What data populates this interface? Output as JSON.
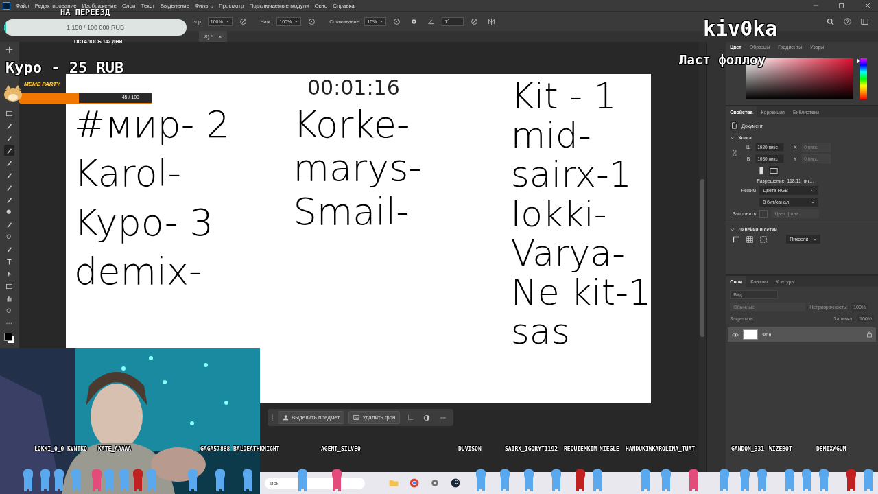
{
  "menu": [
    "Файл",
    "Редактирование",
    "Изображение",
    "Слои",
    "Текст",
    "Выделение",
    "Фильтр",
    "Просмотр",
    "Подключаемые модули",
    "Окно",
    "Справка"
  ],
  "options": [
    {
      "label": "зор.:",
      "value": "100%"
    },
    {
      "label": "Наж.:",
      "value": "100%"
    },
    {
      "label": "Сглаживание:",
      "value": "10%"
    }
  ],
  "angle": "1°",
  "document_tab": {
    "title": "8) *",
    "close": "×"
  },
  "canvas": {
    "columns": [
      [
        "#мир- 2",
        "Karol-",
        "Kypo- 3",
        "demix-"
      ],
      [
        "Korke-",
        "marys-",
        "Smail-"
      ],
      [
        "Kit - 1",
        "mid-",
        "sairx-1",
        "lokki-",
        "Varya-",
        "Ne kit-1",
        "sas"
      ]
    ]
  },
  "color_panel": {
    "tabs": [
      {
        "label": "Цвет",
        "selected": true
      },
      {
        "label": "Образцы",
        "selected": false
      },
      {
        "label": "Градиенты",
        "selected": false
      },
      {
        "label": "Узоры",
        "selected": false
      }
    ],
    "hue": {
      "level": 1
    }
  },
  "properties": {
    "tabs": [
      {
        "label": "Свойства",
        "selected": true
      },
      {
        "label": "Коррекция",
        "selected": false
      },
      {
        "label": "Библиотеки",
        "selected": false
      }
    ],
    "document": "Документ",
    "canvas_section": "Холст",
    "fields": [
      {
        "label": "Ш",
        "value": "1920 пикс",
        "pos_label": "X",
        "pos_placeholder": "0 пикс."
      },
      {
        "label": "В",
        "value": "1080 пикс",
        "pos_label": "Y",
        "pos_placeholder": "0 пикс."
      }
    ],
    "resolution": "Разрешение: 118,11 пик...",
    "mode_label": "Режим",
    "mode": "Цвета RGB",
    "depth": "8 бит/канал",
    "fill_label": "Заполнить",
    "fill_value": "Цвет фона",
    "rulers_section": "Линейки и сетки",
    "units": "Пиксели"
  },
  "layers": {
    "tabs": [
      {
        "label": "Слои",
        "selected": true
      },
      {
        "label": "Каналы",
        "selected": false
      },
      {
        "label": "Контуры",
        "selected": false
      }
    ],
    "search_placeholder": "Вид",
    "blend": "Обычные",
    "opacity_label": "Непрозрачность:",
    "opacity": "100%",
    "lock_label": "Закрепить:",
    "fill_label": "Заливка:",
    "fill": "100%",
    "items": [
      {
        "name": "Фон",
        "visible": true,
        "locked": true
      }
    ]
  },
  "context_bar": {
    "buttons": [
      "Выделить предмет",
      "Удалить фон"
    ]
  },
  "taskbar": {
    "search": "иск"
  },
  "overlays": {
    "goal": {
      "title": "НА ПЕРЕЕЗД",
      "amount": "1 150 / 100 000 RUB",
      "level": 0.0115,
      "remaining": "ОСТАЛОСЬ 142 ДНЯ"
    },
    "last_donation": "Куро - 25 RUB",
    "meme": {
      "title": "MEME PARTY",
      "count": "45 / 100",
      "level": 0.45
    },
    "streamer": "kiv0ka",
    "last_follow": "Ласт фоллоу",
    "timer": "00:01:16",
    "chat_names": [
      "LOKKI_0_0",
      "KVNTKO",
      "KATE_AAAAA",
      "GAGA57888",
      "BALDEATHKNIGHT",
      "AGENT_SILVE0",
      "DUVISON",
      "SAIRX_IGORYT1192",
      "REQUIEMKIM",
      "NIEGLE",
      "HANDUKIWKAROLINA_TUAT",
      "GANDON_331",
      "WIZEBOT",
      "DEMIXWGUM"
    ]
  }
}
